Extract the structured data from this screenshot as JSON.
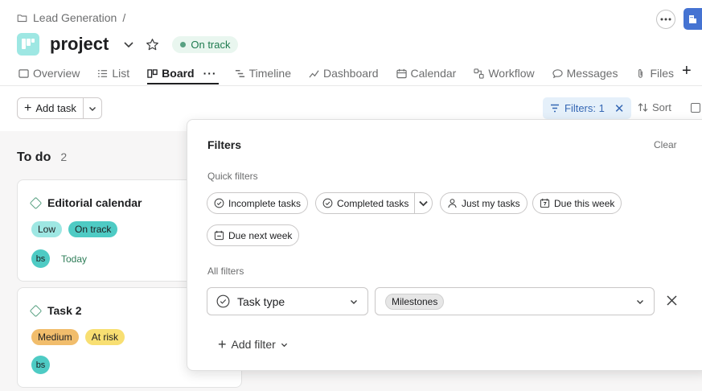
{
  "breadcrumb": {
    "label": "Lead Generation",
    "separator": "/"
  },
  "project": {
    "title": "project",
    "status": "On track"
  },
  "tabs": [
    {
      "label": "Overview",
      "icon": "overview-icon"
    },
    {
      "label": "List",
      "icon": "list-icon"
    },
    {
      "label": "Board",
      "icon": "board-icon",
      "active": true
    },
    {
      "label": "Timeline",
      "icon": "timeline-icon"
    },
    {
      "label": "Dashboard",
      "icon": "dashboard-icon"
    },
    {
      "label": "Calendar",
      "icon": "calendar-icon"
    },
    {
      "label": "Workflow",
      "icon": "workflow-icon"
    },
    {
      "label": "Messages",
      "icon": "messages-icon"
    },
    {
      "label": "Files",
      "icon": "files-icon"
    }
  ],
  "toolbar": {
    "add_task": "Add task",
    "filters": "Filters: 1",
    "sort": "Sort"
  },
  "column": {
    "title": "To do",
    "count": "2",
    "cards": [
      {
        "title": "Editorial calendar",
        "tags": [
          "Low",
          "On track"
        ],
        "assignee": "bs",
        "due": "Today"
      },
      {
        "title": "Task 2",
        "tags": [
          "Medium",
          "At risk"
        ],
        "assignee": "bs",
        "due": ""
      }
    ]
  },
  "filters_panel": {
    "title": "Filters",
    "clear": "Clear",
    "quick_filters_label": "Quick filters",
    "quick_filters": [
      "Incomplete tasks",
      "Completed tasks",
      "Just my tasks",
      "Due this week",
      "Due next week"
    ],
    "all_filters_label": "All filters",
    "field": "Task type",
    "value": "Milestones",
    "add_filter": "Add filter"
  },
  "colors": {
    "accent_blue": "#4573d2",
    "filter_bg": "#e5f0fa",
    "tag_low": "#9ee7e3",
    "tag_on_track": "#4ecbc4",
    "tag_medium": "#f1bd6c",
    "tag_at_risk": "#f8df72",
    "avatar": "#4ecbc4"
  }
}
